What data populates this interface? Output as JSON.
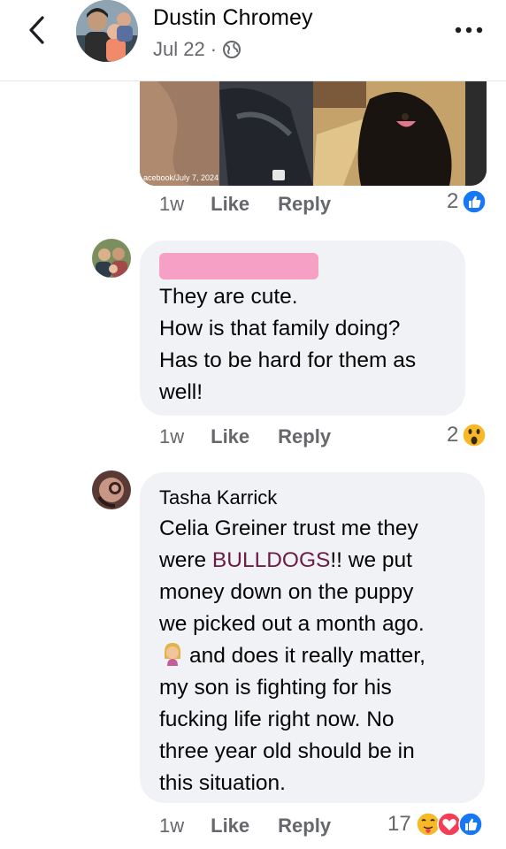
{
  "header": {
    "author": "Dustin Chromey",
    "date": "Jul 22",
    "separator": "·"
  },
  "media": {
    "caption": "acebook/July 7, 2024"
  },
  "icons": {
    "back": "chevron-left-icon",
    "more": "more-dots-icon",
    "privacy": "globe-icon",
    "like_reaction": "like-reaction-icon",
    "wow_reaction": "wow-reaction-icon",
    "care_reaction": "care-reaction-icon",
    "love_reaction": "love-reaction-icon"
  },
  "colors": {
    "like_blue": "#1877f2",
    "love_red": "#f33e58",
    "wow_yellow": "#f7b928",
    "mention": "#6b1d45",
    "bubble": "#f0f2f5"
  },
  "comments": [
    {
      "timestamp": "1w",
      "like_label": "Like",
      "reply_label": "Reply",
      "reaction_count": "2"
    },
    {
      "author_redacted": true,
      "lines": [
        "They are cute.",
        "How is that family doing?",
        "Has to be hard for them as",
        "well!"
      ],
      "timestamp": "1w",
      "like_label": "Like",
      "reply_label": "Reply",
      "reaction_count": "2"
    },
    {
      "author": "Tasha Karrick",
      "line1_pre": "Celia Greiner trust me they",
      "line2_pre": "were ",
      "line2_mention": "BULLDOGS",
      "line2_post": "!! we put",
      "line3": "money down on the puppy",
      "line4": "we picked out a month ago.",
      "line5": "and does it really matter,",
      "line6": "my son is fighting for his",
      "line7": "fucking life right now. No",
      "line8": "three year old should be in",
      "line9": "this situation.",
      "timestamp": "1w",
      "like_label": "Like",
      "reply_label": "Reply",
      "reaction_count": "17"
    }
  ]
}
